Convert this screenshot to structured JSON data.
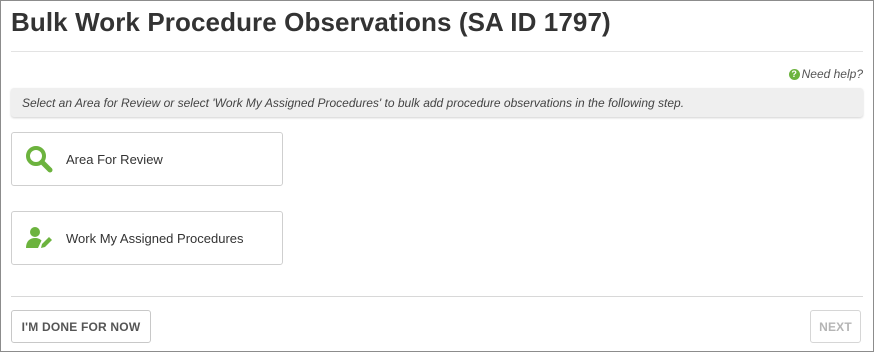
{
  "page": {
    "title": "Bulk Work Procedure Observations (SA ID 1797)"
  },
  "help": {
    "icon": "question-circle-icon",
    "label": "Need help?"
  },
  "info": {
    "message": "Select an Area for Review or select 'Work My Assigned Procedures' to bulk add procedure observations in the following step."
  },
  "options": [
    {
      "label": "Area For Review",
      "icon": "magnifier-search-icon"
    },
    {
      "label": "Work My Assigned Procedures",
      "icon": "user-edit-icon"
    }
  ],
  "footer": {
    "done_label": "I'M DONE FOR NOW",
    "next_label": "NEXT",
    "next_enabled": false
  },
  "colors": {
    "accent_green": "#6cb33e",
    "info_bar_bg": "#efefef",
    "text": "#333333",
    "disabled_text": "#b5b5b5"
  }
}
